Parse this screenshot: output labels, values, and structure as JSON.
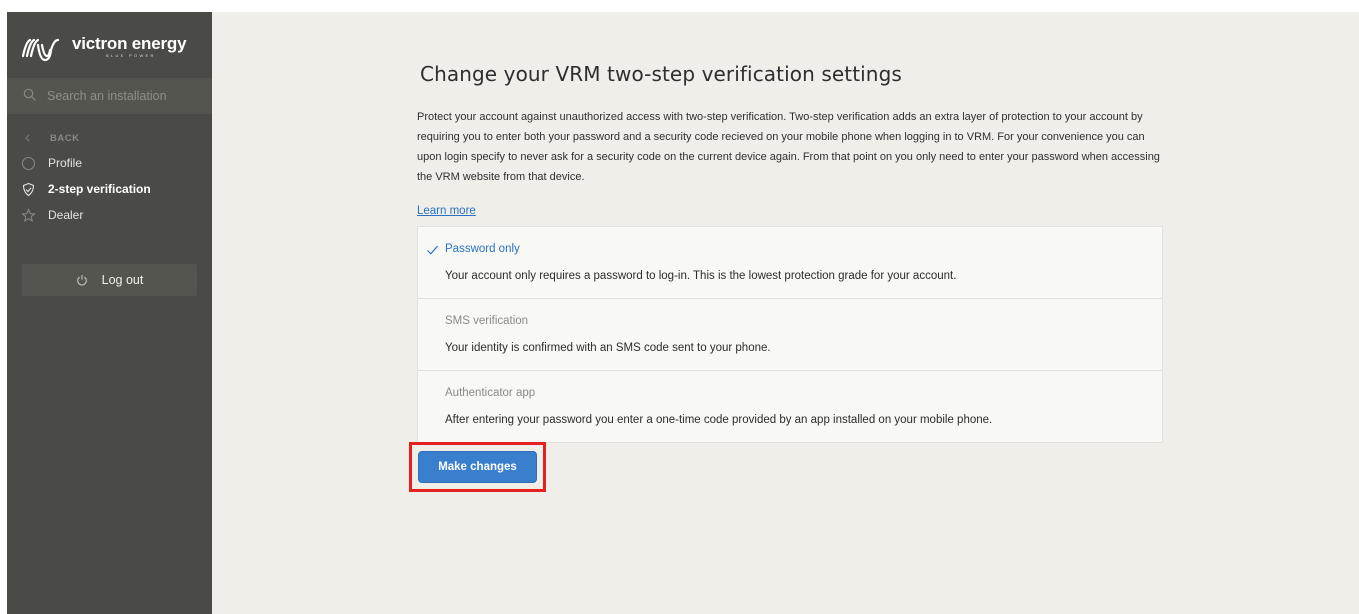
{
  "app": {
    "brand_name": "victron energy",
    "brand_tagline": "BLUE POWER"
  },
  "sidebar": {
    "search": {
      "placeholder": "Search an installation",
      "value": ""
    },
    "back_label": "BACK",
    "items": [
      {
        "label": "Profile",
        "icon": "user-circle-icon",
        "active": false
      },
      {
        "label": "2-step verification",
        "icon": "shield-icon",
        "active": true
      },
      {
        "label": "Dealer",
        "icon": "star-icon",
        "active": false
      }
    ],
    "logout_label": "Log out"
  },
  "main": {
    "title": "Change your VRM two-step verification settings",
    "intro": "Protect your account against unauthorized access with two-step verification. Two-step verification adds an extra layer of protection to your account by requiring you to enter both your password and a security code recieved on your mobile phone when logging in to VRM. For your convenience you can upon login specify to never ask for a security code on the current device again. From that point on you only need to enter your password when accessing the VRM website from that device.",
    "learn_more": "Learn more",
    "options": [
      {
        "title": "Password only",
        "description": "Your account only requires a password to log-in. This is the lowest protection grade for your account.",
        "selected": true
      },
      {
        "title": "SMS verification",
        "description": "Your identity is confirmed with an SMS code sent to your phone.",
        "selected": false
      },
      {
        "title": "Authenticator app",
        "description": "After entering your password you enter a one-time code provided by an app installed on your mobile phone.",
        "selected": false
      }
    ],
    "action_button": "Make changes"
  },
  "colors": {
    "sidebar_bg": "#4a4a46",
    "main_bg": "#efeee9",
    "accent": "#2a71c3",
    "button_bg": "#3a7fce",
    "highlight_border": "#e3211e"
  }
}
